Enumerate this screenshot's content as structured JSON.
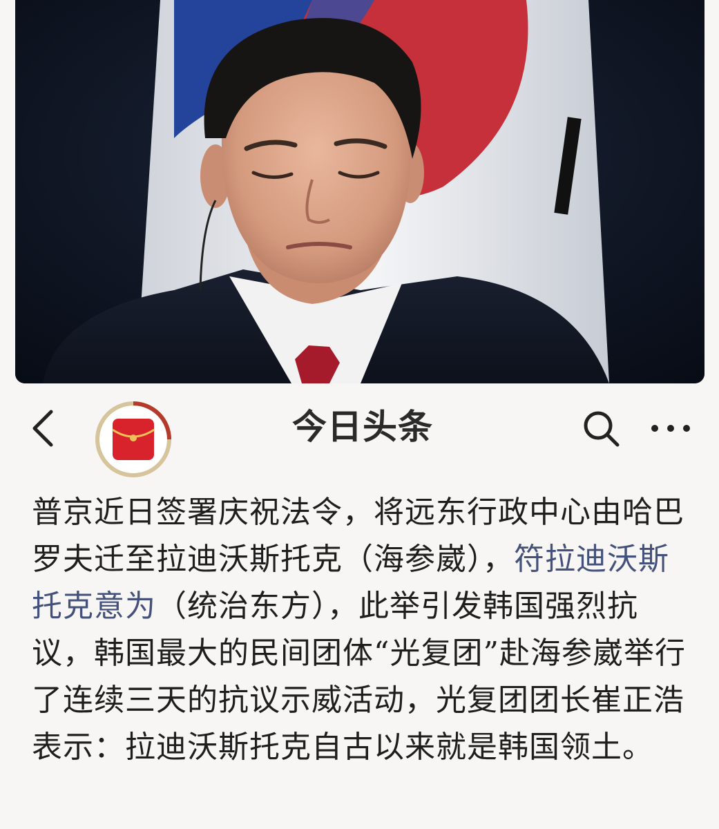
{
  "header": {
    "title": "今日头条",
    "back_icon": "chevron-left-icon",
    "avatar_icon": "red-envelope-icon",
    "search_icon": "search-icon",
    "more_icon": "more-dots-icon"
  },
  "article": {
    "part1": "普京近日签署庆祝法令，将远东行政中心由哈巴罗夫迁至拉迪沃斯托克（海参崴），",
    "part2_link": "符拉迪沃斯托克意为",
    "part3": "（统治东方），此举引发韩国强烈抗议，韩国最大的民间团体“光复团”赴海参崴举行了连续三天的抗议示威活动，光复团团长崔正浩表示：拉迪沃斯托克自古以来就是韩国领土。"
  },
  "colors": {
    "background": "#f7f6f4",
    "text": "#1e1e1e",
    "link": "#44517a",
    "avatar_red": "#d9232c",
    "avatar_ring": "#c9a566"
  }
}
